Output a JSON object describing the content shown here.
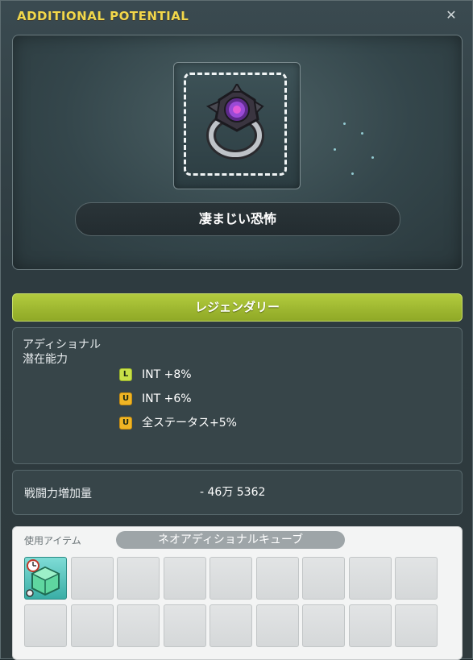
{
  "window": {
    "title": "ADDITIONAL POTENTIAL",
    "close_symbol": "✕"
  },
  "item": {
    "name": "凄まじい恐怖",
    "icon": "dark-ring-icon"
  },
  "grade": {
    "label": "レジェンダリー",
    "color": "#a5bf33"
  },
  "potential": {
    "label_line1": "アディショナル",
    "label_line2": "潜在能力",
    "lines": [
      {
        "badge": "L",
        "badge_color": "#c8e047",
        "text": "INT +8%"
      },
      {
        "badge": "U",
        "badge_color": "#f0b524",
        "text": "INT +6%"
      },
      {
        "badge": "U",
        "badge_color": "#f0b524",
        "text": "全ステータス+5%"
      }
    ]
  },
  "combat_power": {
    "label": "戦闘力増加量",
    "value": "- 46万 5362"
  },
  "use_item": {
    "label": "使用アイテム",
    "selected_name": "ネオアディショナルキューブ",
    "slot_icon": "cube-icon"
  }
}
